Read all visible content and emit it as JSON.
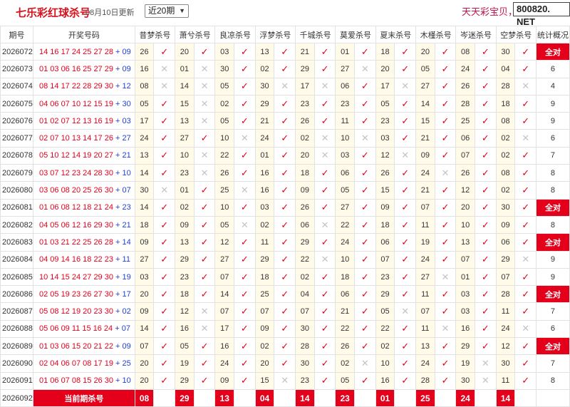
{
  "header": {
    "title": "七乐彩红球杀号",
    "date": "08月10日更新",
    "period_select": "近20期",
    "brand_text": "天天彩宝贝，",
    "brand_box": "800820. NET"
  },
  "columns": {
    "issue": "期号",
    "numbers": "开奖号码",
    "experts": [
      "昔梦杀号",
      "萧兮杀号",
      "良凉杀号",
      "浮梦杀号",
      "千城杀号",
      "莫爱杀号",
      "夏末杀号",
      "木槿杀号",
      "岑迷杀号",
      "空梦杀号"
    ],
    "stats": "统计概况"
  },
  "rows": [
    {
      "issue": "2026072",
      "red": "14 16 17 24 25 27 28",
      "blue": "09",
      "kills": [
        "26",
        "20",
        "03",
        "13",
        "21",
        "01",
        "18",
        "20",
        "08",
        "30"
      ],
      "hits": [
        1,
        1,
        1,
        1,
        1,
        1,
        1,
        1,
        1,
        1
      ],
      "stat": "全对"
    },
    {
      "issue": "2026073",
      "red": "01 03 06 16 25 27 29",
      "blue": "09",
      "kills": [
        "16",
        "01",
        "30",
        "02",
        "29",
        "27",
        "20",
        "05",
        "24",
        "04"
      ],
      "hits": [
        0,
        0,
        1,
        1,
        1,
        0,
        1,
        1,
        1,
        1
      ],
      "stat": "6"
    },
    {
      "issue": "2026074",
      "red": "08 14 17 22 28 29 30",
      "blue": "12",
      "kills": [
        "08",
        "14",
        "05",
        "30",
        "17",
        "06",
        "17",
        "27",
        "26",
        "28"
      ],
      "hits": [
        0,
        0,
        1,
        0,
        0,
        1,
        0,
        1,
        1,
        0
      ],
      "stat": "4"
    },
    {
      "issue": "2026075",
      "red": "04 06 07 10 12 15 19",
      "blue": "30",
      "kills": [
        "05",
        "15",
        "02",
        "29",
        "23",
        "23",
        "05",
        "14",
        "28",
        "18"
      ],
      "hits": [
        1,
        0,
        1,
        1,
        1,
        1,
        1,
        1,
        1,
        1
      ],
      "stat": "9"
    },
    {
      "issue": "2026076",
      "red": "01 02 07 12 13 16 19",
      "blue": "03",
      "kills": [
        "17",
        "13",
        "05",
        "21",
        "26",
        "11",
        "23",
        "15",
        "25",
        "08"
      ],
      "hits": [
        1,
        0,
        1,
        1,
        1,
        1,
        1,
        1,
        1,
        1
      ],
      "stat": "9"
    },
    {
      "issue": "2026077",
      "red": "02 07 10 13 14 17 26",
      "blue": "27",
      "kills": [
        "24",
        "27",
        "10",
        "24",
        "02",
        "10",
        "03",
        "21",
        "06",
        "02"
      ],
      "hits": [
        1,
        1,
        0,
        1,
        0,
        0,
        1,
        1,
        1,
        0
      ],
      "stat": "6"
    },
    {
      "issue": "2026078",
      "red": "05 10 12 14 19 20 27",
      "blue": "21",
      "kills": [
        "13",
        "10",
        "22",
        "01",
        "20",
        "03",
        "12",
        "09",
        "07",
        "02"
      ],
      "hits": [
        1,
        0,
        1,
        1,
        0,
        1,
        0,
        1,
        1,
        1
      ],
      "stat": "7"
    },
    {
      "issue": "2026079",
      "red": "03 07 12 23 24 28 30",
      "blue": "10",
      "kills": [
        "14",
        "23",
        "26",
        "16",
        "18",
        "06",
        "26",
        "24",
        "26",
        "08"
      ],
      "hits": [
        1,
        0,
        1,
        1,
        1,
        1,
        1,
        0,
        1,
        1
      ],
      "stat": "8"
    },
    {
      "issue": "2026080",
      "red": "03 06 08 20 25 26 30",
      "blue": "07",
      "kills": [
        "30",
        "01",
        "25",
        "16",
        "09",
        "05",
        "15",
        "21",
        "12",
        "02"
      ],
      "hits": [
        0,
        1,
        0,
        1,
        1,
        1,
        1,
        1,
        1,
        1
      ],
      "stat": "8"
    },
    {
      "issue": "2026081",
      "red": "01 06 08 12 18 21 24",
      "blue": "23",
      "kills": [
        "14",
        "02",
        "10",
        "03",
        "26",
        "27",
        "09",
        "07",
        "20",
        "30"
      ],
      "hits": [
        1,
        1,
        1,
        1,
        1,
        1,
        1,
        1,
        1,
        1
      ],
      "stat": "全对"
    },
    {
      "issue": "2026082",
      "red": "04 05 06 12 16 29 30",
      "blue": "21",
      "kills": [
        "18",
        "09",
        "05",
        "02",
        "06",
        "22",
        "18",
        "11",
        "10",
        "09"
      ],
      "hits": [
        1,
        1,
        0,
        1,
        0,
        1,
        1,
        1,
        1,
        1
      ],
      "stat": "8"
    },
    {
      "issue": "2026083",
      "red": "01 03 21 22 25 26 28",
      "blue": "14",
      "kills": [
        "09",
        "13",
        "12",
        "11",
        "29",
        "24",
        "06",
        "19",
        "13",
        "06"
      ],
      "hits": [
        1,
        1,
        1,
        1,
        1,
        1,
        1,
        1,
        1,
        1
      ],
      "stat": "全对"
    },
    {
      "issue": "2026084",
      "red": "04 09 14 16 18 22 23",
      "blue": "11",
      "kills": [
        "27",
        "29",
        "27",
        "29",
        "22",
        "10",
        "07",
        "24",
        "07",
        "29"
      ],
      "hits": [
        1,
        1,
        1,
        1,
        0,
        1,
        1,
        1,
        1,
        0
      ],
      "stat": "9"
    },
    {
      "issue": "2026085",
      "red": "10 14 15 24 27 29 30",
      "blue": "19",
      "kills": [
        "03",
        "23",
        "07",
        "18",
        "02",
        "18",
        "23",
        "27",
        "01",
        "07"
      ],
      "hits": [
        1,
        1,
        1,
        1,
        1,
        1,
        1,
        0,
        1,
        1
      ],
      "stat": "9"
    },
    {
      "issue": "2026086",
      "red": "02 05 19 23 26 27 30",
      "blue": "17",
      "kills": [
        "20",
        "18",
        "14",
        "25",
        "04",
        "06",
        "29",
        "11",
        "03",
        "28"
      ],
      "hits": [
        1,
        1,
        1,
        1,
        1,
        1,
        1,
        1,
        1,
        1
      ],
      "stat": "全对"
    },
    {
      "issue": "2026087",
      "red": "05 08 12 19 20 23 30",
      "blue": "02",
      "kills": [
        "09",
        "12",
        "07",
        "07",
        "07",
        "21",
        "05",
        "07",
        "03",
        "11"
      ],
      "hits": [
        1,
        0,
        1,
        1,
        1,
        1,
        0,
        1,
        1,
        1
      ],
      "stat": "7"
    },
    {
      "issue": "2026088",
      "red": "05 06 09 11 15 16 24",
      "blue": "07",
      "kills": [
        "14",
        "16",
        "17",
        "09",
        "30",
        "22",
        "22",
        "11",
        "16",
        "24"
      ],
      "hits": [
        1,
        0,
        1,
        1,
        1,
        1,
        1,
        0,
        1,
        0
      ],
      "stat": "6"
    },
    {
      "issue": "2026089",
      "red": "01 03 06 15 20 21 22",
      "blue": "09",
      "kills": [
        "07",
        "05",
        "16",
        "02",
        "28",
        "26",
        "02",
        "13",
        "29",
        "12"
      ],
      "hits": [
        1,
        1,
        1,
        1,
        1,
        1,
        1,
        1,
        1,
        1
      ],
      "stat": "全对"
    },
    {
      "issue": "2026090",
      "red": "02 04 06 07 08 17 19",
      "blue": "25",
      "kills": [
        "20",
        "19",
        "24",
        "20",
        "30",
        "02",
        "10",
        "24",
        "19",
        "30"
      ],
      "hits": [
        1,
        1,
        1,
        1,
        1,
        0,
        1,
        1,
        0,
        1
      ],
      "stat": "7"
    },
    {
      "issue": "2026091",
      "red": "01 06 07 08 15 26 30",
      "blue": "10",
      "kills": [
        "20",
        "29",
        "09",
        "15",
        "23",
        "05",
        "16",
        "28",
        "30",
        "11"
      ],
      "hits": [
        1,
        1,
        1,
        0,
        1,
        1,
        1,
        1,
        0,
        1
      ],
      "stat": "8"
    }
  ],
  "current": {
    "issue": "2026092",
    "label": "当前期杀号",
    "kills": [
      "08",
      "29",
      "13",
      "04",
      "14",
      "23",
      "01",
      "25",
      "24",
      "14"
    ]
  },
  "glyphs": {
    "ok": "✓",
    "no": "✕"
  },
  "colors": {
    "accent_red": "#e4001b",
    "blue_ball": "#1d3fd8",
    "highlight_bg": "#fffbe8"
  }
}
